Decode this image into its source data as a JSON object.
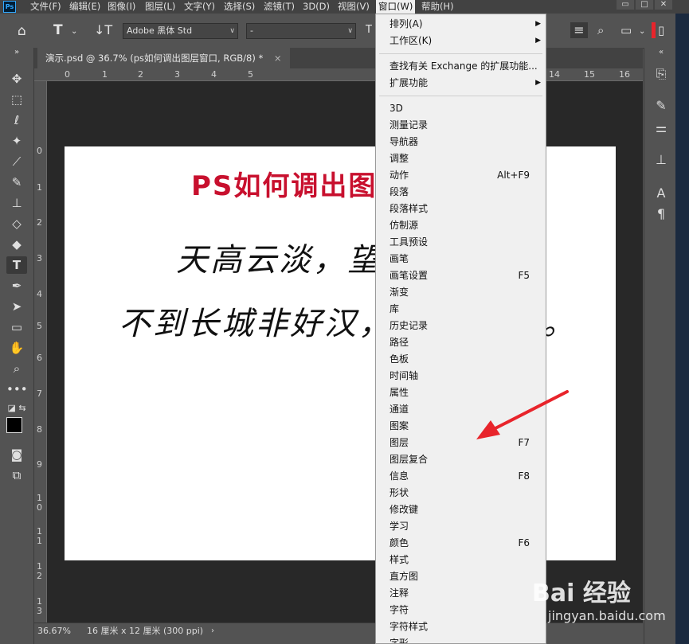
{
  "menubar": {
    "items": [
      "文件(F)",
      "编辑(E)",
      "图像(I)",
      "图层(L)",
      "文字(Y)",
      "选择(S)",
      "滤镜(T)",
      "3D(D)",
      "视图(V)",
      "窗口(W)",
      "帮助(H)"
    ],
    "logo": "Ps"
  },
  "options": {
    "font_family": "Adobe 黑体 Std",
    "font_style": "-"
  },
  "document": {
    "tab_label": "演示.psd @ 36.7% (ps如何调出图层窗口, RGB/8) *",
    "title_text": "PS如何调出图",
    "line1": "天高云淡，望断",
    "line2": "不到长城非好汉，",
    "line2_tail": "。"
  },
  "rulers": {
    "top_labels": [
      "0",
      "1",
      "2",
      "3",
      "4",
      "5",
      "14",
      "15",
      "16"
    ],
    "left_labels": [
      "0",
      "1",
      "2",
      "3",
      "4",
      "5",
      "6",
      "7",
      "8",
      "9",
      "1",
      "0",
      "1",
      "1",
      "1",
      "2",
      "1",
      "3"
    ]
  },
  "status": {
    "zoom": "36.67%",
    "doc_size": "16 厘米 x 12 厘米 (300 ppi)"
  },
  "window_menu": {
    "group1": [
      {
        "label": "排列(A)",
        "submenu": true
      },
      {
        "label": "工作区(K)",
        "submenu": true
      }
    ],
    "group2": [
      {
        "label": "查找有关 Exchange 的扩展功能...",
        "submenu": false
      },
      {
        "label": "扩展功能",
        "submenu": true
      }
    ],
    "group3": [
      {
        "label": "3D",
        "shortcut": ""
      },
      {
        "label": "测量记录",
        "shortcut": ""
      },
      {
        "label": "导航器",
        "shortcut": ""
      },
      {
        "label": "调整",
        "shortcut": ""
      },
      {
        "label": "动作",
        "shortcut": "Alt+F9"
      },
      {
        "label": "段落",
        "shortcut": ""
      },
      {
        "label": "段落样式",
        "shortcut": ""
      },
      {
        "label": "仿制源",
        "shortcut": ""
      },
      {
        "label": "工具预设",
        "shortcut": ""
      },
      {
        "label": "画笔",
        "shortcut": ""
      },
      {
        "label": "画笔设置",
        "shortcut": "F5"
      },
      {
        "label": "渐变",
        "shortcut": ""
      },
      {
        "label": "库",
        "shortcut": ""
      },
      {
        "label": "历史记录",
        "shortcut": ""
      },
      {
        "label": "路径",
        "shortcut": ""
      },
      {
        "label": "色板",
        "shortcut": ""
      },
      {
        "label": "时间轴",
        "shortcut": ""
      },
      {
        "label": "属性",
        "shortcut": ""
      },
      {
        "label": "通道",
        "shortcut": ""
      },
      {
        "label": "图案",
        "shortcut": ""
      },
      {
        "label": "图层",
        "shortcut": "F7"
      },
      {
        "label": "图层复合",
        "shortcut": ""
      },
      {
        "label": "信息",
        "shortcut": "F8"
      },
      {
        "label": "形状",
        "shortcut": ""
      },
      {
        "label": "修改键",
        "shortcut": ""
      },
      {
        "label": "学习",
        "shortcut": ""
      },
      {
        "label": "颜色",
        "shortcut": "F6"
      },
      {
        "label": "样式",
        "shortcut": ""
      },
      {
        "label": "直方图",
        "shortcut": ""
      },
      {
        "label": "注释",
        "shortcut": ""
      },
      {
        "label": "字符",
        "shortcut": ""
      },
      {
        "label": "字符样式",
        "shortcut": ""
      },
      {
        "label": "字形",
        "shortcut": ""
      }
    ]
  },
  "watermark": {
    "brand": "Bai 经验",
    "url": "jingyan.baidu.com"
  },
  "colors": {
    "title_red": "#c8102e",
    "arrow_red": "#e8242b"
  },
  "icons": {
    "home": "home-icon",
    "type_tool": "type-tool-icon"
  }
}
